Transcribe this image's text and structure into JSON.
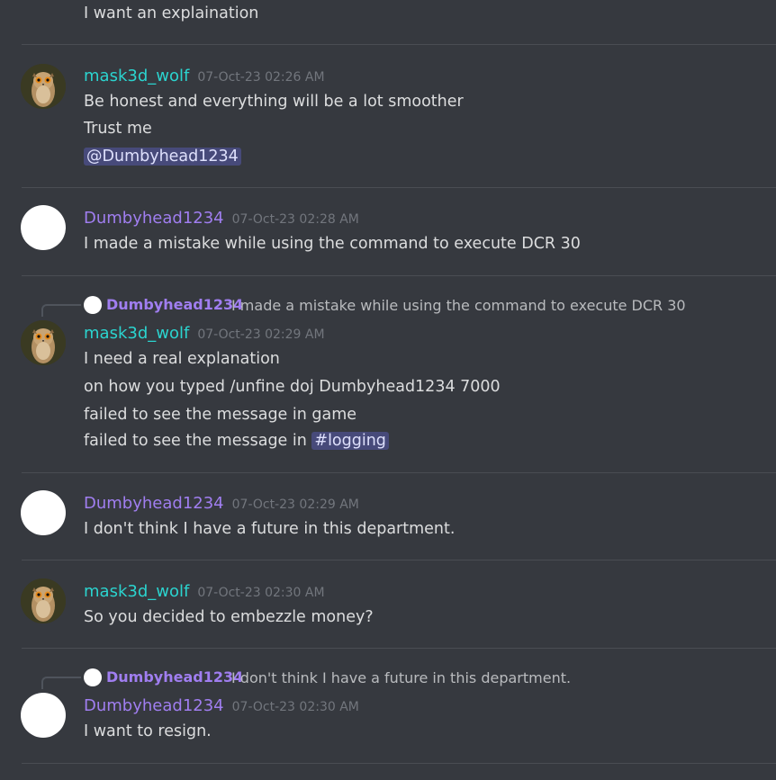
{
  "users": {
    "wolf": "mask3d_wolf",
    "dumby": "Dumbyhead1234"
  },
  "colors": {
    "background": "#36393f",
    "wolf_name": "#2bd4cf",
    "dumby_name": "#a07ef0",
    "timestamp": "#72767d",
    "mention_bg": "#474a7a"
  },
  "top_fragment": "I want an explaination",
  "messages": [
    {
      "author": "mask3d_wolf",
      "avatar": "owl-avatar",
      "timestamp": "07-Oct-23 02:26 AM",
      "lines": [
        "Be honest and everything will be a lot smoother",
        "Trust me"
      ],
      "mention": "@Dumbyhead1234"
    },
    {
      "author": "Dumbyhead1234",
      "avatar": "white-circle-avatar",
      "timestamp": "07-Oct-23 02:28 AM",
      "lines": [
        "I made a mistake while using the command to execute DCR 30"
      ]
    },
    {
      "reply": {
        "author": "Dumbyhead1234",
        "text": "I made a mistake while using the command to execute DCR 30"
      },
      "author": "mask3d_wolf",
      "avatar": "owl-avatar",
      "timestamp": "07-Oct-23 02:29 AM",
      "lines": [
        "I need a real explanation",
        "on how you typed /unfine doj Dumbyhead1234 7000",
        "failed to see the message in game",
        "failed to see the message in "
      ],
      "channel": "#logging"
    },
    {
      "author": "Dumbyhead1234",
      "avatar": "white-circle-avatar",
      "timestamp": "07-Oct-23 02:29 AM",
      "lines": [
        "I don't think I have a future in this department."
      ]
    },
    {
      "author": "mask3d_wolf",
      "avatar": "owl-avatar",
      "timestamp": "07-Oct-23 02:30 AM",
      "lines": [
        "So you decided to embezzle money?"
      ]
    },
    {
      "reply": {
        "author": "Dumbyhead1234",
        "text": "I don't think I have a future in this department."
      },
      "author": "Dumbyhead1234",
      "avatar": "white-circle-avatar",
      "timestamp": "07-Oct-23 02:30 AM",
      "lines": [
        "I want to resign."
      ]
    }
  ]
}
